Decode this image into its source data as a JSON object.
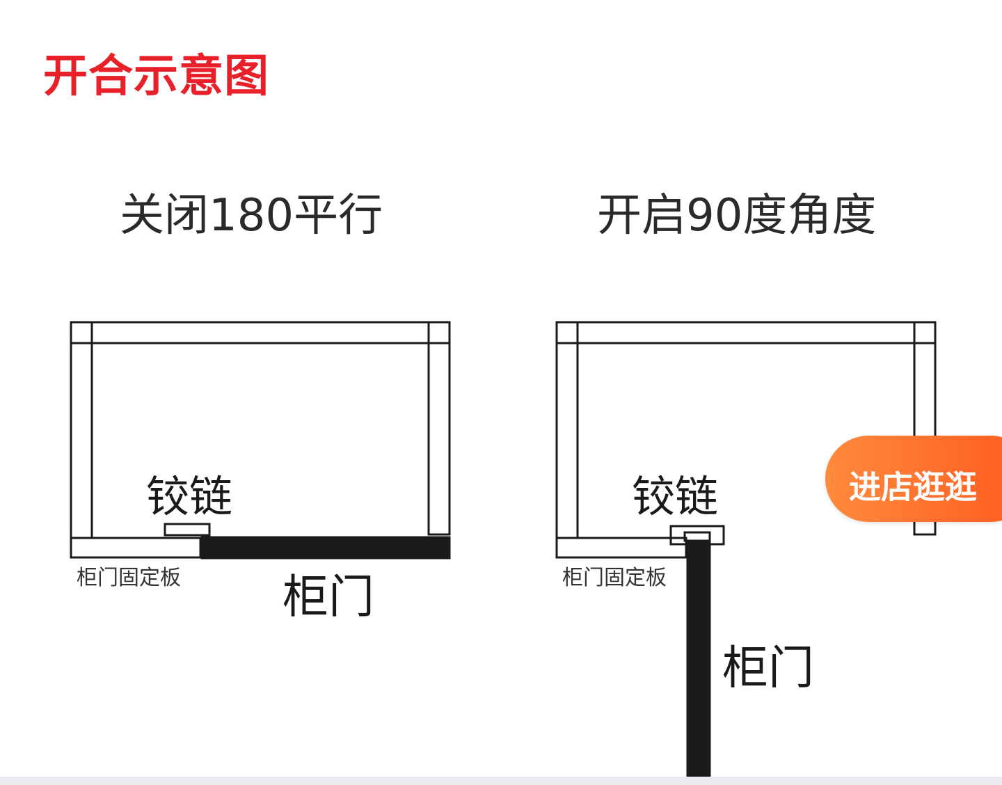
{
  "title": "开合示意图",
  "closed": {
    "heading": "关闭180平行",
    "hinge_label": "铰链",
    "plate_label": "柜门固定板",
    "door_label": "柜门"
  },
  "open": {
    "heading": "开启90度角度",
    "hinge_label": "铰链",
    "plate_label": "柜门固定板",
    "door_label": "柜门"
  },
  "shop_button": {
    "label": "进店逛逛",
    "color": "#ff6a2a"
  },
  "colors": {
    "title": "#e8202a",
    "line": "#1a1a1a"
  }
}
